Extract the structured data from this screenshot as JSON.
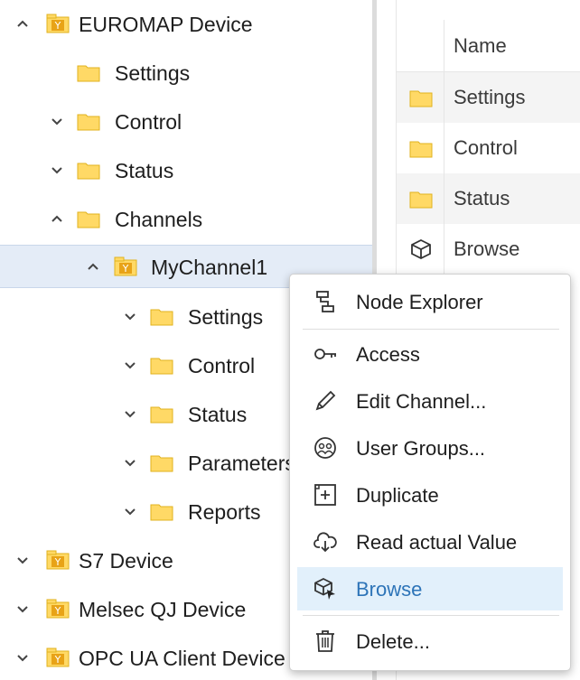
{
  "tree": {
    "nodes": [
      {
        "label": "EUROMAP Device"
      },
      {
        "label": "Settings"
      },
      {
        "label": "Control"
      },
      {
        "label": "Status"
      },
      {
        "label": "Channels"
      },
      {
        "label": "MyChannel1"
      },
      {
        "label": "Settings"
      },
      {
        "label": "Control"
      },
      {
        "label": "Status"
      },
      {
        "label": "Parameters"
      },
      {
        "label": "Reports"
      },
      {
        "label": "S7 Device"
      },
      {
        "label": "Melsec QJ Device"
      },
      {
        "label": "OPC UA Client Device"
      }
    ]
  },
  "grid": {
    "header": {
      "name": "Name"
    },
    "rows": [
      {
        "name": "Settings",
        "icon": "folder-icon"
      },
      {
        "name": "Control",
        "icon": "folder-icon"
      },
      {
        "name": "Status",
        "icon": "folder-icon"
      },
      {
        "name": "Browse",
        "icon": "cube-icon"
      }
    ]
  },
  "menu": {
    "items": [
      {
        "label": "Node Explorer",
        "icon": "node-explorer-icon"
      },
      {
        "label": "Access",
        "icon": "key-icon"
      },
      {
        "label": "Edit Channel...",
        "icon": "pencil-icon"
      },
      {
        "label": "User Groups...",
        "icon": "user-groups-icon"
      },
      {
        "label": "Duplicate",
        "icon": "duplicate-icon"
      },
      {
        "label": "Read actual Value",
        "icon": "cloud-read-icon"
      },
      {
        "label": "Browse",
        "icon": "browse-icon"
      },
      {
        "label": "Delete...",
        "icon": "trash-icon"
      }
    ]
  },
  "colors": {
    "folder": "#ffd966",
    "device_icon": "#e8a317",
    "selected_row": "#e4ecf7",
    "menu_hover": "#e2f0fb",
    "menu_hover_text": "#2d74b8"
  }
}
